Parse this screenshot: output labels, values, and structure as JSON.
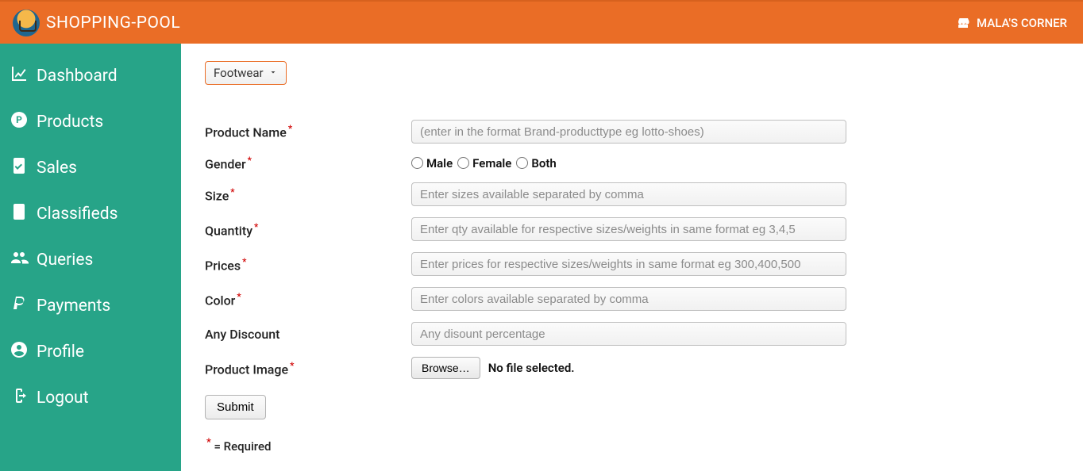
{
  "header": {
    "brand": "SHOPPING-POOL",
    "right_label": "MALA'S CORNER"
  },
  "sidebar": {
    "items": [
      {
        "label": "Dashboard"
      },
      {
        "label": "Products"
      },
      {
        "label": "Sales"
      },
      {
        "label": "Classifieds"
      },
      {
        "label": "Queries"
      },
      {
        "label": "Payments"
      },
      {
        "label": "Profile"
      },
      {
        "label": "Logout"
      }
    ]
  },
  "category": {
    "selected": "Footwear"
  },
  "form": {
    "product_name": {
      "label": "Product Name",
      "placeholder": "(enter in the format Brand-producttype eg lotto-shoes)"
    },
    "gender": {
      "label": "Gender",
      "options": {
        "male": "Male",
        "female": "Female",
        "both": "Both"
      }
    },
    "size": {
      "label": "Size",
      "placeholder": "Enter sizes available separated by comma"
    },
    "quantity": {
      "label": "Quantity",
      "placeholder": "Enter qty available for respective sizes/weights in same format eg 3,4,5"
    },
    "prices": {
      "label": "Prices",
      "placeholder": "Enter prices for respective sizes/weights in same format eg 300,400,500"
    },
    "color": {
      "label": "Color",
      "placeholder": "Enter colors available separated by comma"
    },
    "discount": {
      "label": "Any Discount",
      "placeholder": "Any disount percentage"
    },
    "image": {
      "label": "Product Image",
      "browse": "Browse…",
      "no_file": "No file selected."
    },
    "submit": "Submit",
    "required_note": "= Required",
    "asterisk": "*"
  }
}
